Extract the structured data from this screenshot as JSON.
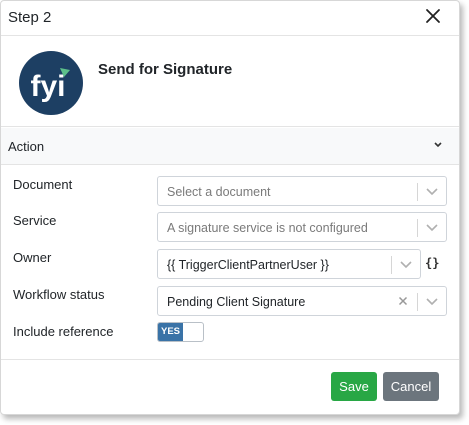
{
  "dialog": {
    "title": "Step 2",
    "close_icon": "close-icon"
  },
  "app": {
    "logo_text": "fyi",
    "logo_colors": {
      "background": "#1d3f63",
      "accent": "#5cc08a"
    },
    "name": "Send for Signature"
  },
  "section": {
    "title": "Action",
    "chevron_icon": "chevron-down-icon"
  },
  "fields": {
    "document": {
      "label": "Document",
      "placeholder": "Select a document"
    },
    "service": {
      "label": "Service",
      "placeholder": "A signature service is not configured"
    },
    "owner": {
      "label": "Owner",
      "value": "{{ TriggerClientPartnerUser }}",
      "variable_icon": "{}"
    },
    "workflow_status": {
      "label": "Workflow status",
      "value": "Pending Client Signature"
    },
    "include_reference": {
      "label": "Include reference",
      "toggle_label": "YES",
      "enabled": true
    }
  },
  "footer": {
    "save_label": "Save",
    "cancel_label": "Cancel"
  },
  "colors": {
    "save": "#28a745",
    "cancel": "#6c757d",
    "toggle_on": "#3a73a7",
    "section_bg": "#f8f9fa"
  }
}
